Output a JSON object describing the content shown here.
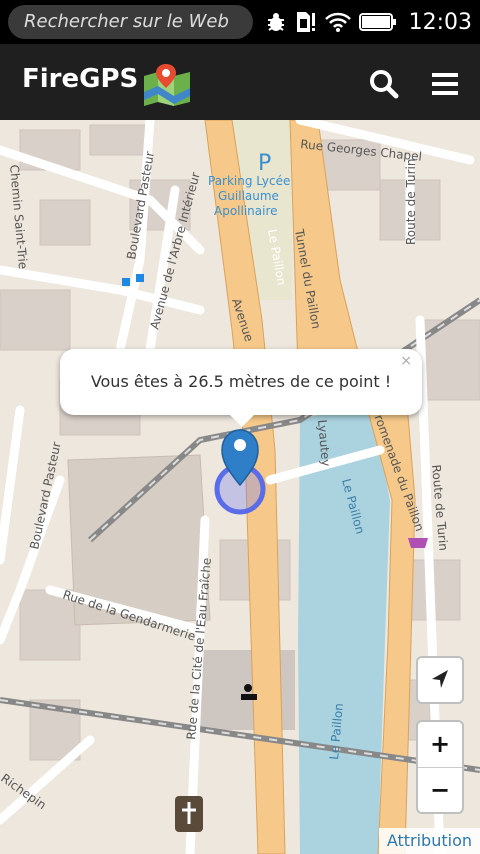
{
  "status_bar": {
    "search_placeholder": "Rechercher sur le Web",
    "time": "12:03",
    "icons": [
      "bug-icon",
      "sim-alert-icon",
      "wifi-icon",
      "battery-icon"
    ]
  },
  "app": {
    "title": "FireGPS",
    "icons": [
      "map-logo-icon",
      "search-icon",
      "menu-icon"
    ]
  },
  "map": {
    "labels": {
      "street1": "Rue Georges Chapel",
      "parking": "Parking Lycée Guillaume Apollinaire",
      "parking_l1": "Parking Lycée",
      "parking_l2": "Guillaume",
      "parking_l3": "Apollinaire",
      "parking_p": "P",
      "paillon_top": "Le Paillon",
      "tunnel": "Tunnel du Paillon",
      "route_turin_top": "Route de Turin",
      "bd_pasteur_top": "Boulevard Pasteur",
      "av_arbre": "Avenue de l'Arbre Intérieur",
      "chemin": "Chemin Saint-Trie",
      "avenue_top": "Avenue",
      "lyautey": "Lyautey",
      "promenade": "Promenade du Paillon",
      "paillon_mid": "Le Paillon",
      "route_turin_bottom": "Route de Turin",
      "bd_pasteur_bottom": "Boulevard Pasteur",
      "gendarmerie": "Rue de la Gendarmerie",
      "cite": "Rue de la Cité de l'Eau Fraîche",
      "paillon_bottom": "Le Paillon",
      "richepin": "Richepin"
    },
    "popup": {
      "message": "Vous êtes à 26.5 mètres de ce point !",
      "close": "×"
    },
    "controls": {
      "zoom_in": "+",
      "zoom_out": "−"
    },
    "attribution": "Attribution",
    "colors": {
      "road_main": "#f6c98a",
      "river": "#aad3df",
      "marker": "#2f7fc8",
      "accuracy_ring": "#5b6ce8"
    }
  }
}
